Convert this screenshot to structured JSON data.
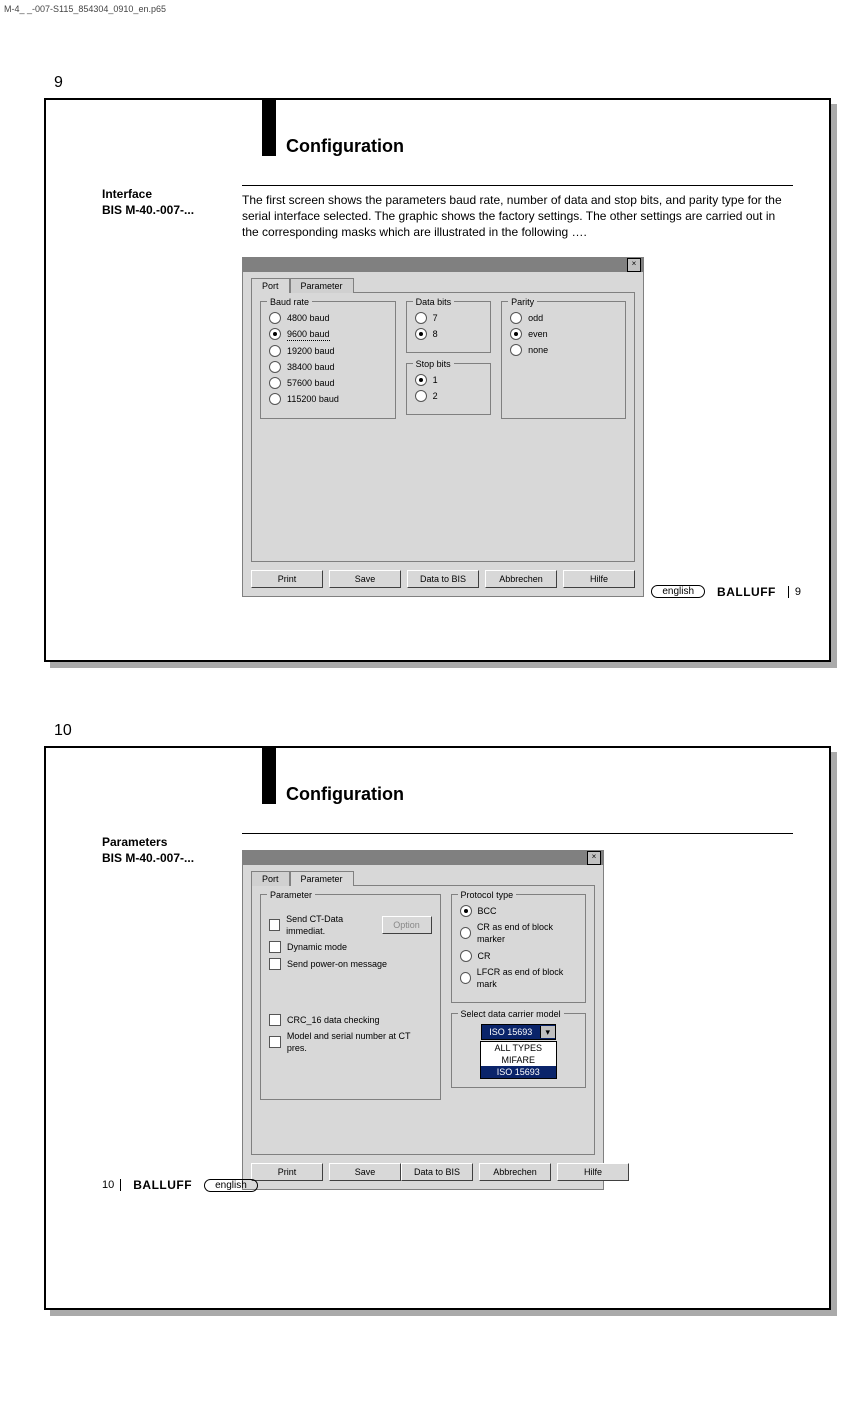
{
  "file_path": "M-4_ _-007-S115_854304_0910_en.p65",
  "brand": "BALLUFF",
  "language_badge": "english",
  "pages": [
    {
      "numTop": "9",
      "section": "Configuration",
      "sidebarLine1": "Interface",
      "sidebarLine2": "BIS M-40.-007-...",
      "bodyText": "The first screen shows the parameters baud rate, number of data and stop bits, and parity type for the serial interface selected. The graphic shows the factory settings. The other settings are carried out in the corresponding masks which are illustrated in the following ….",
      "footerPageNum": "9",
      "dialog": {
        "tabs": {
          "port": "Port",
          "parameter": "Parameter",
          "active": "port"
        },
        "baud": {
          "legend": "Baud rate",
          "options": [
            {
              "label": "4800 baud",
              "sel": false
            },
            {
              "label": "9600 baud",
              "sel": true,
              "dotted": true
            },
            {
              "label": "19200 baud",
              "sel": false
            },
            {
              "label": "38400 baud",
              "sel": false
            },
            {
              "label": "57600 baud",
              "sel": false
            },
            {
              "label": "115200 baud",
              "sel": false
            }
          ]
        },
        "databits": {
          "legend": "Data bits",
          "opts": [
            {
              "label": "7",
              "sel": false
            },
            {
              "label": "8",
              "sel": true
            }
          ]
        },
        "stopbits": {
          "legend": "Stop bits",
          "opts": [
            {
              "label": "1",
              "sel": true
            },
            {
              "label": "2",
              "sel": false
            }
          ]
        },
        "parity": {
          "legend": "Parity",
          "opts": [
            {
              "label": "odd",
              "sel": false
            },
            {
              "label": "even",
              "sel": true
            },
            {
              "label": "none",
              "sel": false
            }
          ]
        },
        "buttons": {
          "print": "Print",
          "save": "Save",
          "dataToBis": "Data to BIS",
          "cancel": "Abbrechen",
          "help": "Hilfe"
        }
      }
    },
    {
      "numTop": "10",
      "section": "Configuration",
      "sidebarLine1": "Parameters",
      "sidebarLine2": "BIS M-40.-007-...",
      "footerPageNum": "10",
      "dialog": {
        "tabs": {
          "port": "Port",
          "parameter": "Parameter",
          "active": "parameter"
        },
        "param": {
          "legend": "Parameter",
          "checks": [
            {
              "label": "Send CT-Data immediat.",
              "sel": false,
              "hasOption": true,
              "optionLabel": "Option"
            },
            {
              "label": "Dynamic mode",
              "sel": false
            },
            {
              "label": "Send power-on message",
              "sel": false
            },
            {
              "label": "CRC_16 data checking",
              "sel": false
            },
            {
              "label": "Model and serial number at CT pres.",
              "sel": false
            }
          ]
        },
        "protocol": {
          "legend": "Protocol type",
          "opts": [
            {
              "label": "BCC",
              "sel": true,
              "type": "radio"
            },
            {
              "label": "CR as end of block marker",
              "sel": false,
              "type": "radio"
            },
            {
              "label": "CR",
              "sel": false,
              "type": "radio"
            },
            {
              "label": "LFCR as end of block mark",
              "sel": false,
              "type": "radio"
            }
          ]
        },
        "carrier": {
          "legend": "Select data carrier model",
          "selected": "ISO 15693",
          "options": [
            "ALL TYPES",
            "MIFARE",
            "ISO 15693"
          ]
        },
        "buttons": {
          "print": "Print",
          "save": "Save",
          "dataToBis": "Data to BIS",
          "cancel": "Abbrechen",
          "help": "Hilfe"
        }
      }
    }
  ]
}
